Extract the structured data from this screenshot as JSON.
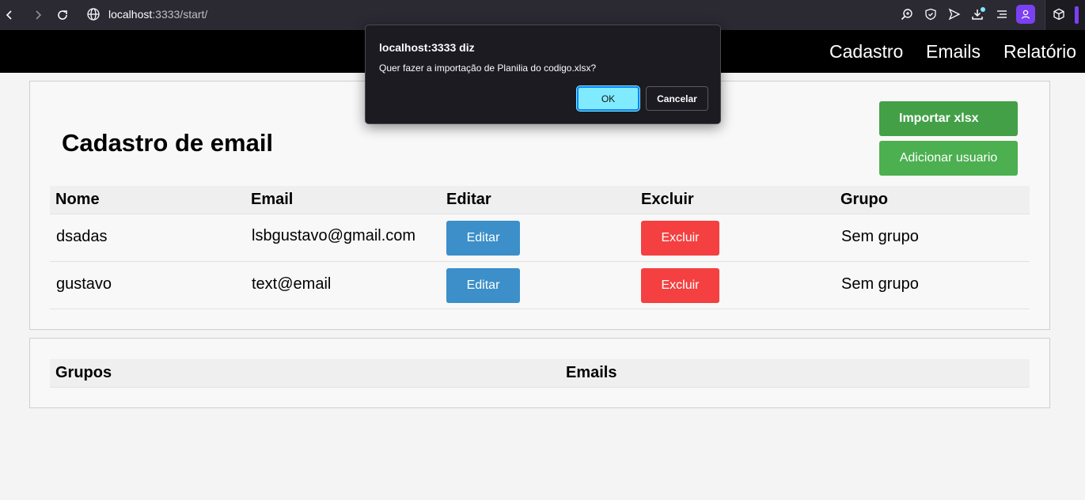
{
  "browser": {
    "url_host": "localhost",
    "url_path": ":3333/start/"
  },
  "nav": {
    "items": [
      "Cadastro",
      "Emails",
      "Relatório"
    ]
  },
  "main": {
    "title": "Cadastro de email",
    "import_button": "Importar xlsx",
    "add_button": "Adicionar usuario",
    "table": {
      "headers": [
        "Nome",
        "Email",
        "Editar",
        "Excluir",
        "Grupo"
      ],
      "rows": [
        {
          "nome": "dsadas",
          "email": "lsbgustavo@gmail.com",
          "edit": "Editar",
          "delete": "Excluir",
          "grupo": "Sem grupo"
        },
        {
          "nome": "gustavo",
          "email": "text@email",
          "edit": "Editar",
          "delete": "Excluir",
          "grupo": "Sem grupo"
        }
      ]
    }
  },
  "groups": {
    "headers": [
      "Grupos",
      "Emails"
    ]
  },
  "dialog": {
    "title": "localhost:3333 diz",
    "message": "Quer fazer a importação de Planilia do codigo.xlsx?",
    "ok": "OK",
    "cancel": "Cancelar"
  },
  "colors": {
    "import": "#43a047",
    "add": "#4caf50",
    "edit": "#3c8fc9",
    "delete": "#f44040",
    "accent": "#7b40f2"
  }
}
